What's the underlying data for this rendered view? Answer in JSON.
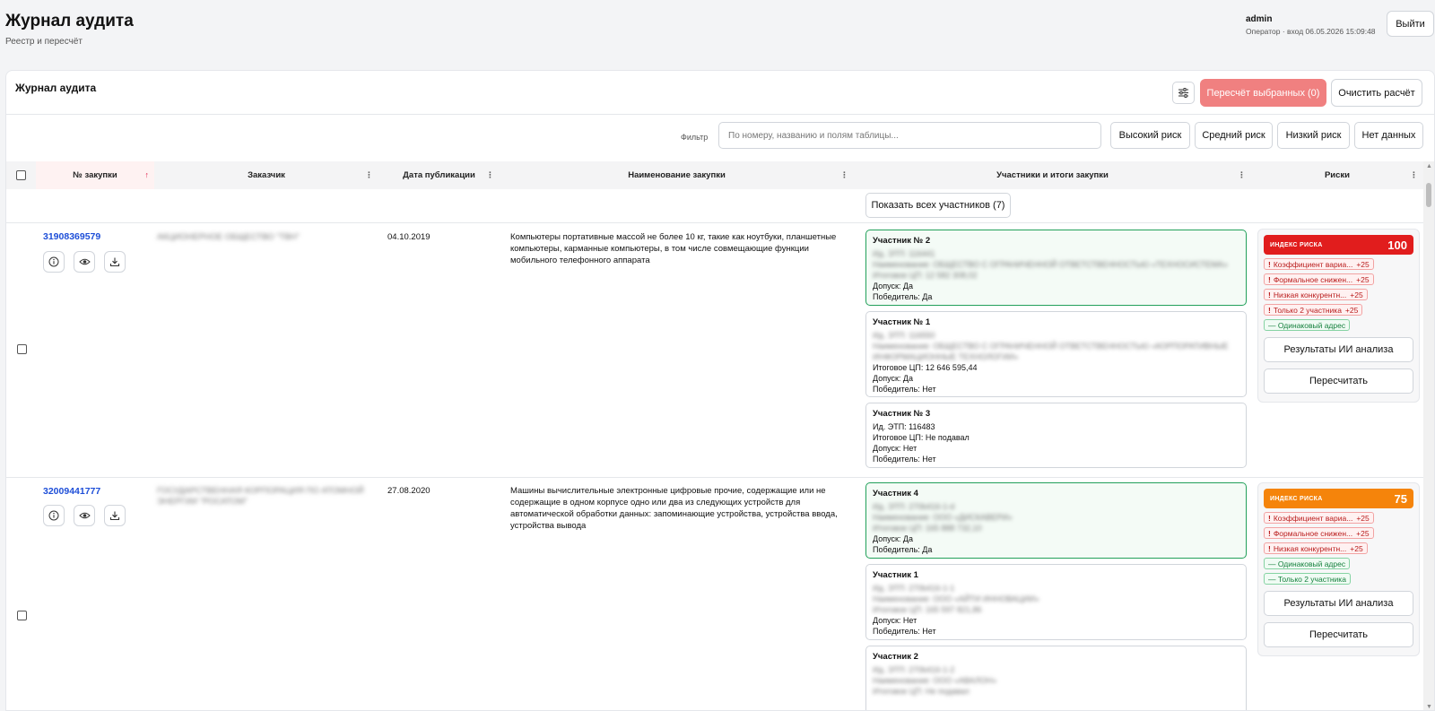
{
  "header": {
    "title": "Журнал аудита",
    "subtitle": "Реестр и пересчёт",
    "user_name": "admin",
    "user_info": "Оператор · вход 06.05.2026 15:09:48",
    "logout_label": "Выйти"
  },
  "card": {
    "title": "Журнал аудита",
    "recalc_selected_label": "Пересчёт выбранных (0)",
    "clear_label": "Очистить расчёт"
  },
  "filter": {
    "label": "Фильтр",
    "placeholder": "По номеру, названию и полям таблицы...",
    "risk_buttons": [
      "Высокий риск",
      "Средний риск",
      "Низкий риск",
      "Нет данных"
    ]
  },
  "table": {
    "columns": [
      "№ закупки",
      "Заказчик",
      "Дата публикации",
      "Наименование закупки",
      "Участники и итоги закупки",
      "Риски"
    ],
    "show_all_label": "Показать всех участников (7)"
  },
  "rows": [
    {
      "number": "31908369579",
      "customer": "АКЦИОНЕРНОЕ ОБЩЕСТВО \"ТВН\"",
      "date": "04.10.2019",
      "name": "Компьютеры портативные массой не более 10 кг, такие как ноутбуки, планшетные компьютеры, карманные компьютеры, в том числе совмещающие функции мобильного телефонного аппарата",
      "participants": [
        {
          "title": "Участник № 2",
          "winner": true,
          "blur_lines": [
            "Ид. ЭТП: 116441",
            "Наименование: ОБЩЕСТВО С ОГРАНИЧЕННОЙ ОТВЕТСТВЕННОСТЬЮ «ТЕХНОСИСТЕМА»",
            "Итоговое ЦП: 12 582 308,02"
          ],
          "lines": [
            "Допуск: Да",
            "Победитель: Да"
          ]
        },
        {
          "title": "Участник № 1",
          "winner": false,
          "blur_lines": [
            "Ид. ЭТП: 116550",
            "Наименование: ОБЩЕСТВО С ОГРАНИЧЕННОЙ ОТВЕТСТВЕННОСТЬЮ «КОРПОРАТИВНЫЕ",
            "ИНФОРМАЦИОННЫЕ ТЕХНОЛОГИИ»"
          ],
          "lines": [
            "Итоговое ЦП: 12 646 595,44",
            "Допуск: Да",
            "Победитель: Нет"
          ]
        },
        {
          "title": "Участник № 3",
          "winner": false,
          "blur_lines": [],
          "lines": [
            "Ид. ЭТП: 116483",
            "Итоговое ЦП: Не подавал",
            "Допуск: Нет",
            "Победитель: Нет"
          ]
        }
      ],
      "risk": {
        "label": "ИНДЕКС РИСКА",
        "value": "100",
        "color": "#e11d1d",
        "tags": [
          {
            "text": "Коэффициент вариа...",
            "pts": "+25",
            "kind": "bad"
          },
          {
            "text": "Формальное снижен...",
            "pts": "+25",
            "kind": "bad"
          },
          {
            "text": "Низкая конкурентн...",
            "pts": "+25",
            "kind": "bad"
          },
          {
            "text": "Только 2 участника",
            "pts": "+25",
            "kind": "bad"
          },
          {
            "text": "— Одинаковый адрес",
            "pts": "",
            "kind": "ok"
          }
        ],
        "ai_label": "Результаты ИИ анализа",
        "recalc_label": "Пересчитать"
      }
    },
    {
      "number": "32009441777",
      "customer": "ГОСУДАРСТВЕННАЯ КОРПОРАЦИЯ ПО АТОМНОЙ ЭНЕРГИИ \"РОСАТОМ\"",
      "date": "27.08.2020",
      "name": "Машины вычислительные электронные цифровые прочие, содержащие или не содержащие в одном корпусе одно или два из следующих устройств для автоматической обработки данных: запоминающие устройства, устройства ввода, устройства вывода",
      "participants": [
        {
          "title": "Участник 4",
          "winner": true,
          "blur_lines": [
            "Ид. ЭТП: 270b416-1-d",
            "Наименование: ООО «ДИСКАВЕРИ»",
            "Итоговое ЦП: 165 888 732,10"
          ],
          "lines": [
            "Допуск: Да",
            "Победитель: Да"
          ]
        },
        {
          "title": "Участник 1",
          "winner": false,
          "blur_lines": [
            "Ид. ЭТП: 270b416-1-1",
            "Наименование: ООО «АЙТИ ИННОВАЦИИ»",
            "Итоговое ЦП: 165 597 821,86"
          ],
          "lines": [
            "Допуск: Нет",
            "Победитель: Нет"
          ]
        },
        {
          "title": "Участник 2",
          "winner": false,
          "blur_lines": [
            "Ид. ЭТП: 270b416-1-2",
            "Наименование: ООО «АВАЛОН»",
            "Итоговое ЦП: Не подавал"
          ],
          "lines": []
        }
      ],
      "risk": {
        "label": "ИНДЕКС РИСКА",
        "value": "75",
        "color": "#f5840b",
        "tags": [
          {
            "text": "Коэффициент вариа...",
            "pts": "+25",
            "kind": "bad"
          },
          {
            "text": "Формальное снижен...",
            "pts": "+25",
            "kind": "bad"
          },
          {
            "text": "Низкая конкурентн...",
            "pts": "+25",
            "kind": "bad"
          },
          {
            "text": "— Одинаковый адрес",
            "pts": "",
            "kind": "ok"
          },
          {
            "text": "— Только 2 участника",
            "pts": "",
            "kind": "ok"
          }
        ],
        "ai_label": "Результаты ИИ анализа",
        "recalc_label": "Пересчитать"
      }
    }
  ]
}
